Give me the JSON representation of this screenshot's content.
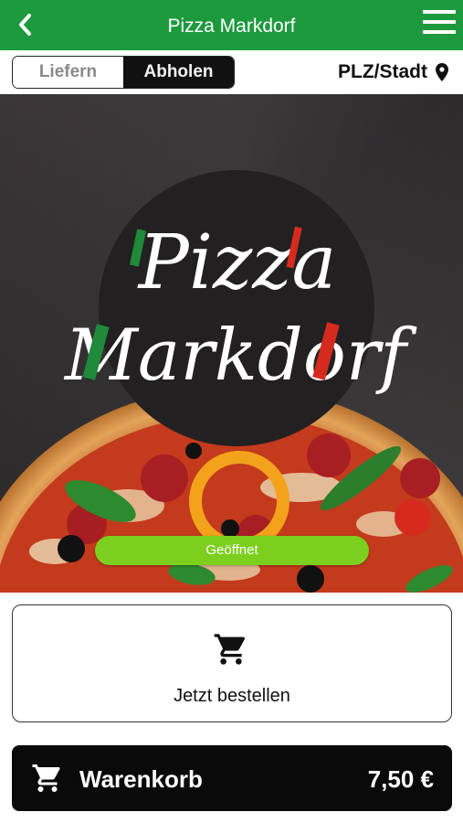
{
  "header": {
    "title": "Pizza Markdorf",
    "back_icon": "chevron-left-icon",
    "menu_icon": "hamburger-menu-icon"
  },
  "mode": {
    "options": [
      "Liefern",
      "Abholen"
    ],
    "selected": "Abholen",
    "location_label": "PLZ/Stadt",
    "location_icon": "map-pin-icon"
  },
  "hero": {
    "logo_line1": "Pizza",
    "logo_line2": "Markdorf",
    "status": "Geöffnet"
  },
  "order": {
    "label": "Jetzt bestellen",
    "icon": "cart-icon"
  },
  "basket": {
    "label": "Warenkorb",
    "price": "7,50 €",
    "icon": "cart-icon"
  },
  "colors": {
    "brand_green": "#1d9a3e",
    "status_green": "#7ccf1e",
    "italy_red": "#d52b1e",
    "italy_green": "#1f8a3a"
  }
}
